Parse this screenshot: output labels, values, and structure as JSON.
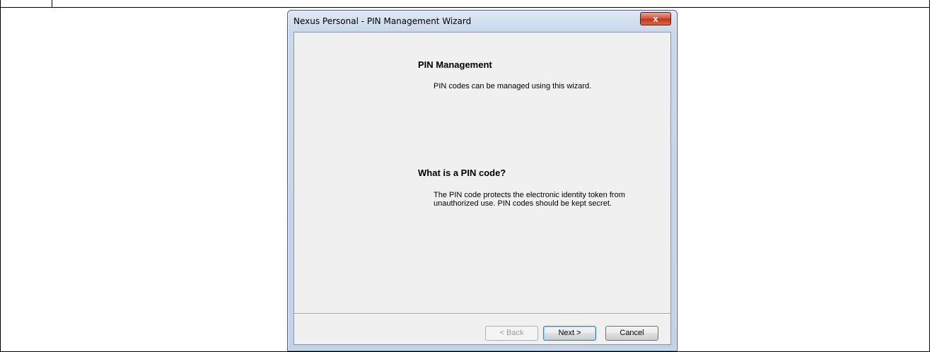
{
  "window": {
    "title": "Nexus Personal - PIN Management Wizard",
    "close_label": "x"
  },
  "content": {
    "heading1": "PIN Management",
    "text1": "PIN codes can be managed using this wizard.",
    "heading2": "What is a PIN code?",
    "text2": "The PIN code protects the electronic identity token from unauthorized use. PIN codes should be kept secret."
  },
  "buttons": {
    "back_label": "< Back",
    "next_label": "Next >",
    "cancel_label": "Cancel"
  }
}
